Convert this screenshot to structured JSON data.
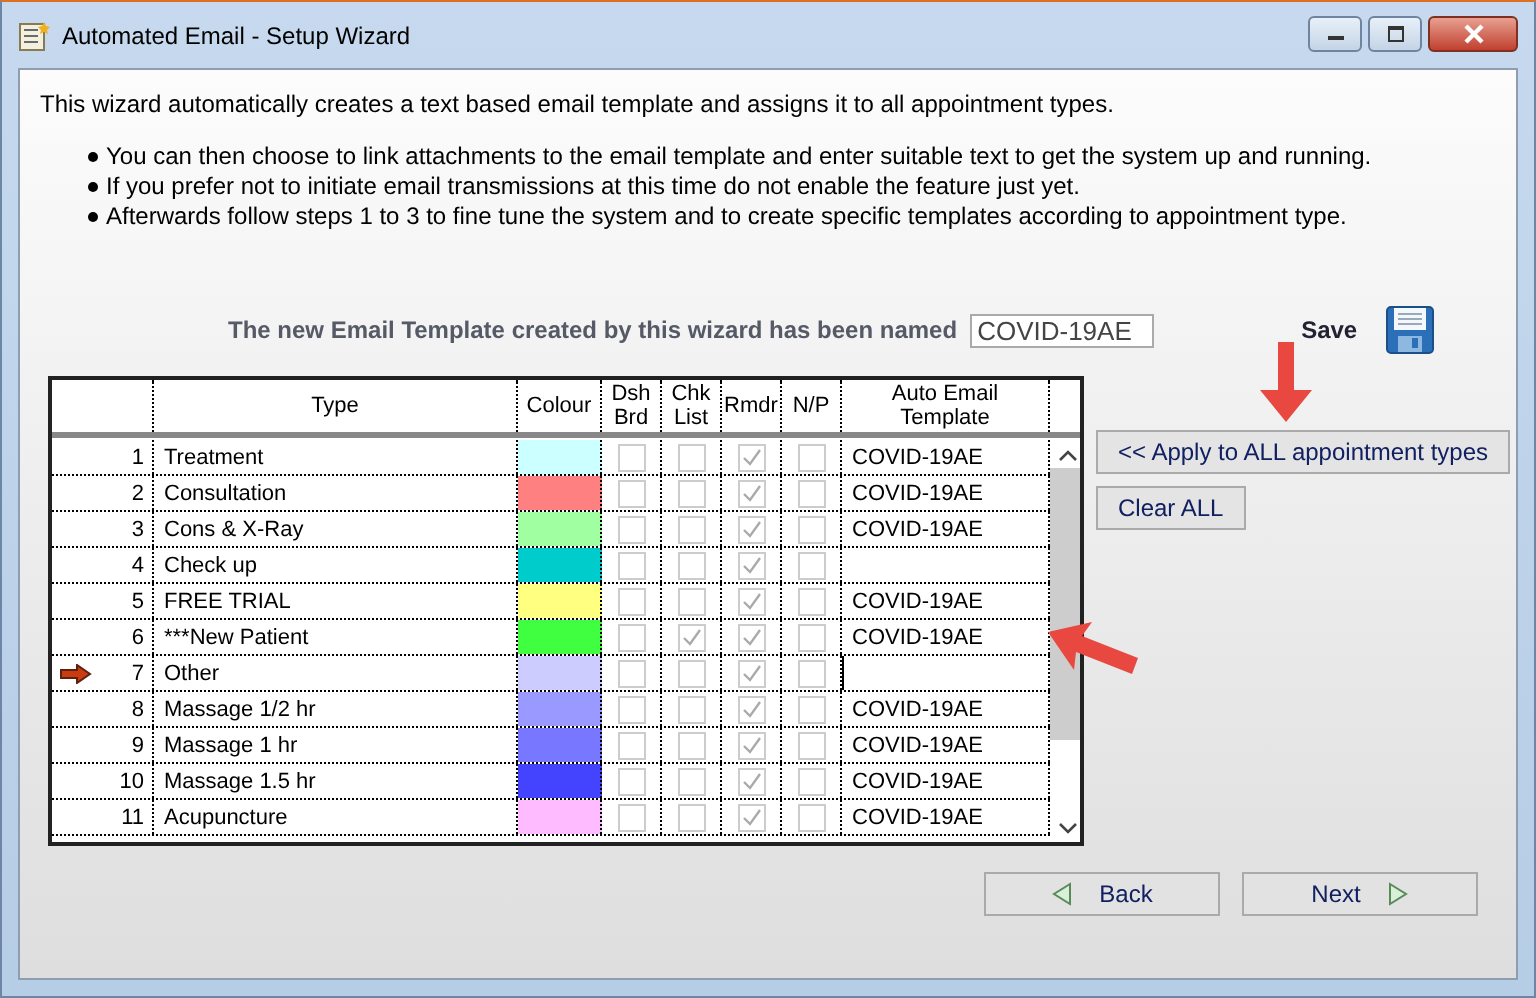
{
  "window": {
    "title": "Automated Email - Setup Wizard"
  },
  "intro": "This wizard automatically creates a text based email template and assigns it to all appointment types.",
  "bullets": [
    "You can then choose to link attachments to the email template and enter suitable text to get the system up and running.",
    "If you prefer not to initiate email transmissions at this time do not enable the feature just yet.",
    "Afterwards follow steps 1 to 3 to fine tune the system and to create specific templates according to appointment type."
  ],
  "template_name": {
    "label": "The new Email Template created by this wizard has been named",
    "value": "COVID-19AE"
  },
  "save": {
    "label": "Save"
  },
  "table": {
    "columns": [
      "Type",
      "Colour",
      "Dsh Brd",
      "Chk List",
      "Rmdr",
      "N/P",
      "Auto Email Template"
    ],
    "rows": [
      {
        "number": "1",
        "type": "Treatment",
        "color": "#ccffff",
        "dsh_brd": false,
        "chk_list": false,
        "rmdr": true,
        "np": false,
        "template": "COVID-19AE",
        "selected": false,
        "editing": false
      },
      {
        "number": "2",
        "type": "Consultation",
        "color": "#ff8080",
        "dsh_brd": false,
        "chk_list": false,
        "rmdr": true,
        "np": false,
        "template": "COVID-19AE",
        "selected": false,
        "editing": false
      },
      {
        "number": "3",
        "type": "Cons & X-Ray",
        "color": "#a0ffa0",
        "dsh_brd": false,
        "chk_list": false,
        "rmdr": true,
        "np": false,
        "template": "COVID-19AE",
        "selected": false,
        "editing": false
      },
      {
        "number": "4",
        "type": "Check up",
        "color": "#00cccc",
        "dsh_brd": false,
        "chk_list": false,
        "rmdr": true,
        "np": false,
        "selected": false,
        "editing": false
      },
      {
        "number": "5",
        "type": "FREE TRIAL",
        "color": "#ffff80",
        "dsh_brd": false,
        "chk_list": false,
        "rmdr": true,
        "np": false,
        "template": "COVID-19AE",
        "selected": false,
        "editing": false
      },
      {
        "number": "6",
        "type": "***New Patient",
        "color": "#40ff40",
        "dsh_brd": false,
        "chk_list": true,
        "rmdr": true,
        "np": false,
        "template": "COVID-19AE",
        "selected": false,
        "editing": false
      },
      {
        "number": "7",
        "type": "Other",
        "color": "#ccccff",
        "dsh_brd": false,
        "chk_list": false,
        "rmdr": true,
        "np": false,
        "selected": true,
        "editing": true
      },
      {
        "number": "8",
        "type": "Massage 1/2 hr",
        "color": "#9999ff",
        "dsh_brd": false,
        "chk_list": false,
        "rmdr": true,
        "np": false,
        "template": "COVID-19AE",
        "selected": false,
        "editing": false
      },
      {
        "number": "9",
        "type": "Massage 1 hr",
        "color": "#7777ff",
        "dsh_brd": false,
        "chk_list": false,
        "rmdr": true,
        "np": false,
        "template": "COVID-19AE",
        "selected": false,
        "editing": false
      },
      {
        "number": "10",
        "type": "Massage 1.5 hr",
        "color": "#4444ff",
        "dsh_brd": false,
        "chk_list": false,
        "rmdr": true,
        "np": false,
        "template": "COVID-19AE",
        "selected": false,
        "editing": false
      },
      {
        "number": "11",
        "type": "Acupuncture",
        "color": "#ffbbff",
        "dsh_brd": false,
        "chk_list": false,
        "rmdr": true,
        "np": false,
        "template": "COVID-19AE",
        "selected": false,
        "editing": false
      }
    ]
  },
  "side_buttons": [
    {
      "label": "<< Apply to ALL appointment types"
    },
    {
      "label": "Clear ALL"
    }
  ],
  "nav_buttons": [
    {
      "label": "Back",
      "kind": "back"
    },
    {
      "label": "Next",
      "kind": "next"
    }
  ]
}
